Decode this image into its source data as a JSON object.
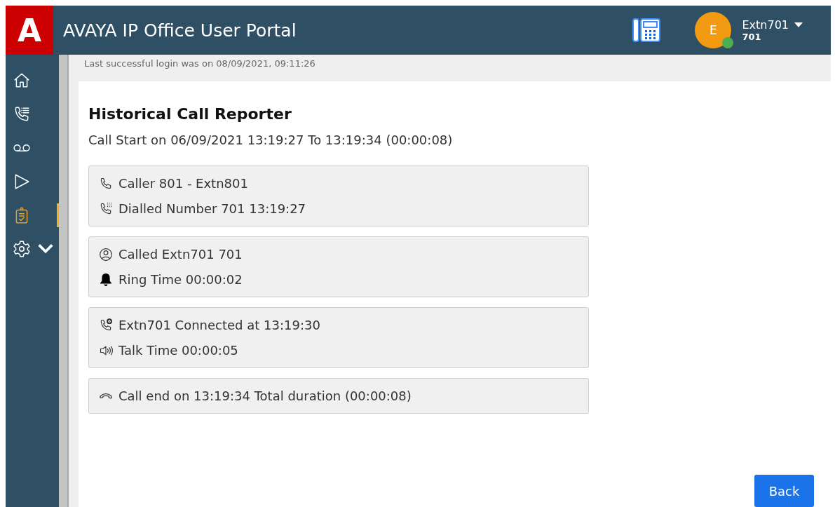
{
  "header": {
    "logo": "A",
    "title": "AVAYA IP Office User Portal",
    "user": {
      "name": "Extn701",
      "extension": "701",
      "initial": "E",
      "online": true
    }
  },
  "sidebar": {
    "items": [
      {
        "kind": "home",
        "selected": false
      },
      {
        "kind": "call-log",
        "selected": false
      },
      {
        "kind": "voicemail",
        "selected": false
      },
      {
        "kind": "play",
        "selected": false
      },
      {
        "kind": "report",
        "selected": true
      },
      {
        "kind": "settings",
        "selected": false
      }
    ]
  },
  "login_notice": "Last successful login was on 08/09/2021, 09:11:26",
  "page": {
    "title": "Historical Call Reporter",
    "subtitle": "Call Start on 06/09/2021 13:19:27 To 13:19:34 (00:00:08)",
    "cards": [
      {
        "lines": [
          {
            "kind": "phone",
            "text": "Caller 801 - Extn801"
          },
          {
            "kind": "dial",
            "text": "Dialled Number 701 13:19:27"
          }
        ]
      },
      {
        "lines": [
          {
            "kind": "person",
            "text": "Called Extn701 701"
          },
          {
            "kind": "bell",
            "text": "Ring Time 00:00:02"
          }
        ]
      },
      {
        "lines": [
          {
            "kind": "connected",
            "text": "Extn701 Connected at 13:19:30"
          },
          {
            "kind": "speaker",
            "text": "Talk Time 00:00:05"
          }
        ]
      },
      {
        "lines": [
          {
            "kind": "hangup",
            "text": "Call end on 13:19:34 Total duration (00:00:08)"
          }
        ]
      }
    ],
    "back_button": "Back"
  }
}
